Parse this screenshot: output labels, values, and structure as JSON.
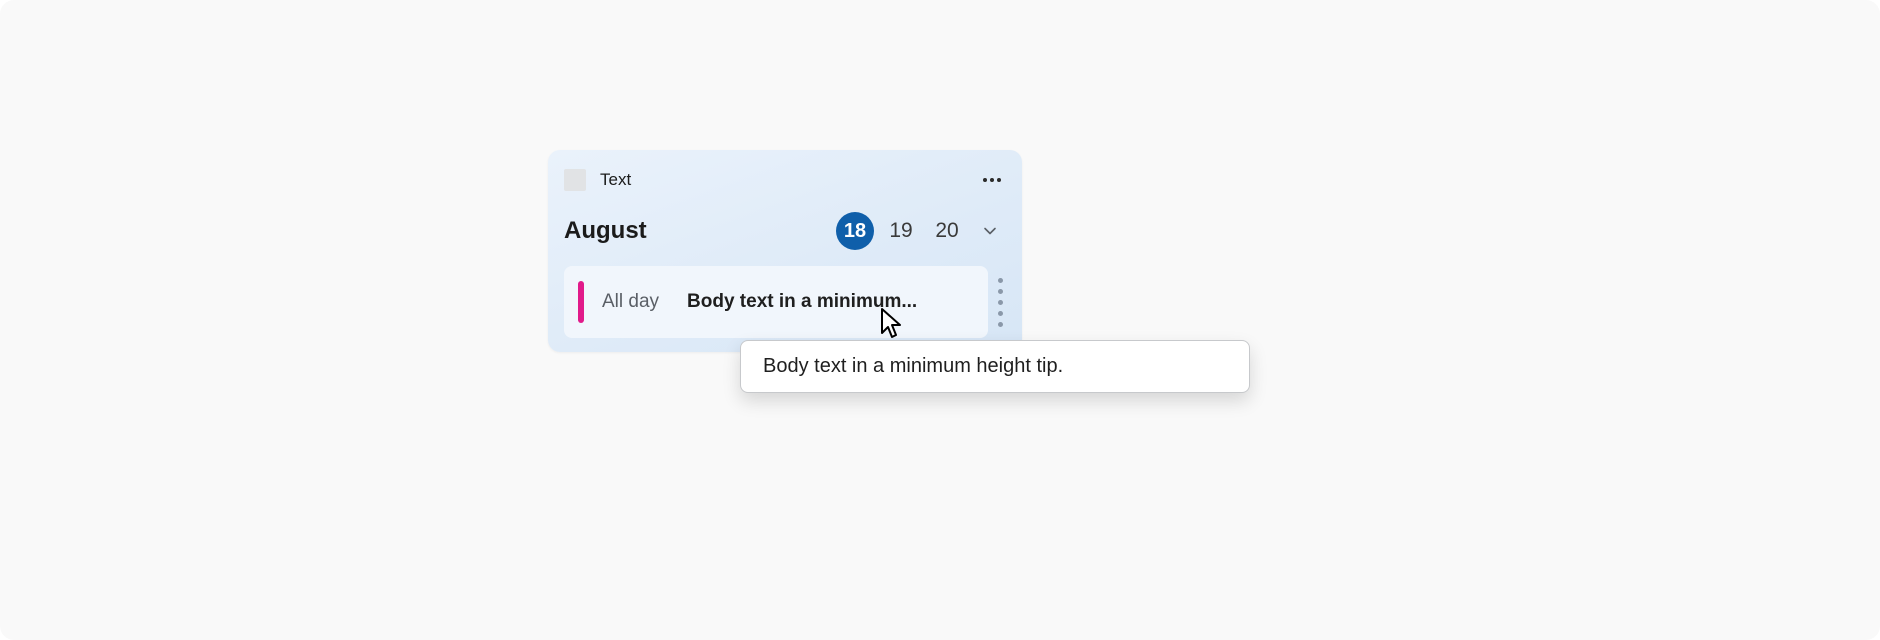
{
  "header": {
    "title": "Text"
  },
  "calendar": {
    "month": "August",
    "days": [
      "18",
      "19",
      "20"
    ],
    "selected_index": 0
  },
  "event": {
    "time_label": "All day",
    "title_truncated": "Body text in a minimum...",
    "accent_color": "#e11a8a"
  },
  "tooltip": {
    "text": "Body text in a minimum height tip."
  },
  "colors": {
    "card_bg_start": "#eaf2fb",
    "card_bg_end": "#d7e6f6",
    "selected_day": "#0f5faa",
    "stage_bg": "#f9f9f9"
  }
}
